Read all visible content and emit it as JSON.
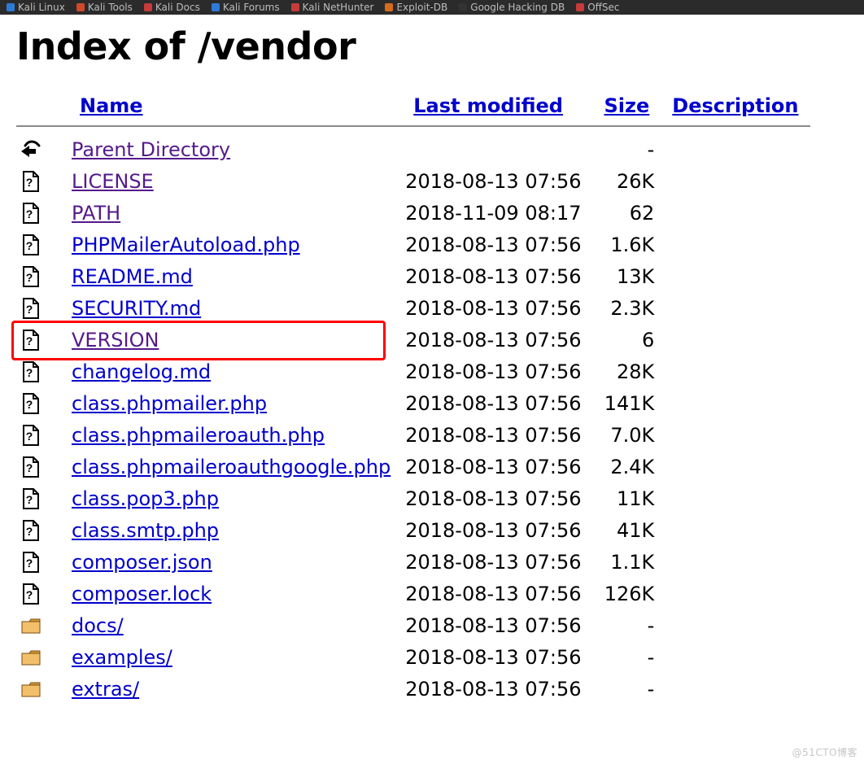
{
  "bookmarks": [
    {
      "label": "Kali Linux",
      "icon_color": "#2d7bd8"
    },
    {
      "label": "Kali Tools",
      "icon_color": "#d04a2a"
    },
    {
      "label": "Kali Docs",
      "icon_color": "#c73b3b"
    },
    {
      "label": "Kali Forums",
      "icon_color": "#2d7bd8"
    },
    {
      "label": "Kali NetHunter",
      "icon_color": "#c73b3b"
    },
    {
      "label": "Exploit-DB",
      "icon_color": "#d66a1d"
    },
    {
      "label": "Google Hacking DB",
      "icon_color": "#333333"
    },
    {
      "label": "OffSec",
      "icon_color": "#c73b3b"
    }
  ],
  "page": {
    "title": "Index of /vendor"
  },
  "columns": {
    "name": "Name",
    "last_modified": "Last modified",
    "size": "Size",
    "description": "Description"
  },
  "entries": [
    {
      "icon": "back",
      "name": "Parent Directory",
      "date": "",
      "size": "-",
      "link_state": "visited",
      "highlighted": false
    },
    {
      "icon": "file",
      "name": "LICENSE",
      "date": "2018-08-13 07:56",
      "size": "26K",
      "link_state": "visited",
      "highlighted": false
    },
    {
      "icon": "file",
      "name": "PATH",
      "date": "2018-11-09 08:17",
      "size": "62",
      "link_state": "visited",
      "highlighted": false
    },
    {
      "icon": "file",
      "name": "PHPMailerAutoload.php",
      "date": "2018-08-13 07:56",
      "size": "1.6K",
      "link_state": "normal",
      "highlighted": false
    },
    {
      "icon": "file",
      "name": "README.md",
      "date": "2018-08-13 07:56",
      "size": "13K",
      "link_state": "normal",
      "highlighted": false
    },
    {
      "icon": "file",
      "name": "SECURITY.md",
      "date": "2018-08-13 07:56",
      "size": "2.3K",
      "link_state": "normal",
      "highlighted": false
    },
    {
      "icon": "file",
      "name": "VERSION",
      "date": "2018-08-13 07:56",
      "size": "6",
      "link_state": "visited",
      "highlighted": true
    },
    {
      "icon": "file",
      "name": "changelog.md",
      "date": "2018-08-13 07:56",
      "size": "28K",
      "link_state": "normal",
      "highlighted": false
    },
    {
      "icon": "file",
      "name": "class.phpmailer.php",
      "date": "2018-08-13 07:56",
      "size": "141K",
      "link_state": "normal",
      "highlighted": false
    },
    {
      "icon": "file",
      "name": "class.phpmaileroauth.php",
      "date": "2018-08-13 07:56",
      "size": "7.0K",
      "link_state": "normal",
      "highlighted": false
    },
    {
      "icon": "file",
      "name": "class.phpmaileroauthgoogle.php",
      "date": "2018-08-13 07:56",
      "size": "2.4K",
      "link_state": "normal",
      "highlighted": false
    },
    {
      "icon": "file",
      "name": "class.pop3.php",
      "date": "2018-08-13 07:56",
      "size": "11K",
      "link_state": "normal",
      "highlighted": false
    },
    {
      "icon": "file",
      "name": "class.smtp.php",
      "date": "2018-08-13 07:56",
      "size": "41K",
      "link_state": "normal",
      "highlighted": false
    },
    {
      "icon": "file",
      "name": "composer.json",
      "date": "2018-08-13 07:56",
      "size": "1.1K",
      "link_state": "normal",
      "highlighted": false
    },
    {
      "icon": "file",
      "name": "composer.lock",
      "date": "2018-08-13 07:56",
      "size": "126K",
      "link_state": "normal",
      "highlighted": false
    },
    {
      "icon": "folder",
      "name": "docs/",
      "date": "2018-08-13 07:56",
      "size": "-",
      "link_state": "normal",
      "highlighted": false
    },
    {
      "icon": "folder",
      "name": "examples/",
      "date": "2018-08-13 07:56",
      "size": "-",
      "link_state": "normal",
      "highlighted": false
    },
    {
      "icon": "folder",
      "name": "extras/",
      "date": "2018-08-13 07:56",
      "size": "-",
      "link_state": "normal",
      "highlighted": false
    }
  ],
  "watermark": "@51CTO博客"
}
